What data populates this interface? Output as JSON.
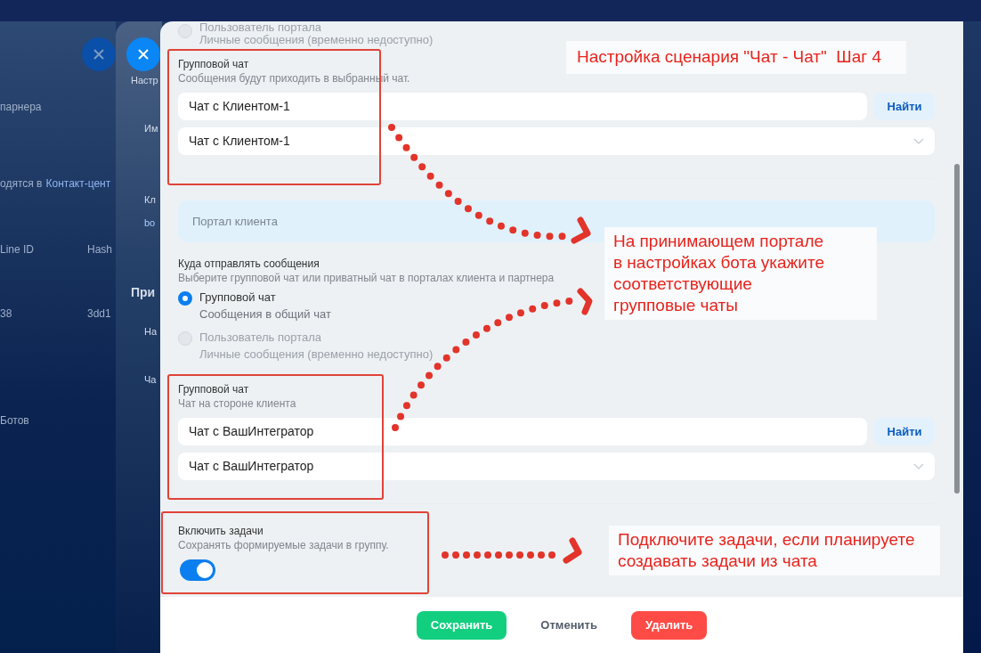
{
  "back_panel": {
    "texts": [
      {
        "kind": "text",
        "text": "парнера"
      },
      {
        "kind": "link-line",
        "text": "одятся в",
        "link": "Контакт-цент"
      },
      {
        "kind": "pair",
        "text": "Line ID",
        "second": "Hash"
      },
      {
        "kind": "pair",
        "text": "38",
        "second": "3dd1"
      },
      {
        "kind": "text",
        "text": "Ботов"
      }
    ]
  },
  "middle_panel": {
    "texts": [
      {
        "kind": "hint",
        "text": "Настр"
      },
      {
        "kind": "label",
        "text": "Им"
      },
      {
        "kind": "label",
        "text": "Кл"
      },
      {
        "kind": "link",
        "text": "bo"
      },
      {
        "kind": "heading",
        "text": "При"
      },
      {
        "kind": "label",
        "text": "На"
      },
      {
        "kind": "label",
        "text": "Ча"
      }
    ]
  },
  "form": {
    "top_option": {
      "label": "Пользователь портала",
      "hint": "Личные сообщения (временно недоступно)",
      "selected": false,
      "disabled": true
    },
    "partner_chat": {
      "label": "Групповой чат",
      "hint": "Сообщения будут приходить в выбранный чат.",
      "search_value": "Чат с Клиентом-1",
      "search_button": "Найти",
      "selected_chat": "Чат с Клиентом-1"
    },
    "client_portal": {
      "title": "Портал клиента"
    },
    "destination": {
      "label": "Куда отправлять сообщения",
      "hint": "Выберите групповой чат или приватный чат в порталах клиента и партнера",
      "options": [
        {
          "label": "Групповой чат",
          "hint": "Сообщения в общий чат",
          "selected": true,
          "disabled": false
        },
        {
          "label": "Пользователь портала",
          "hint": "Личные сообщения (временно недоступно)",
          "selected": false,
          "disabled": true
        }
      ]
    },
    "client_chat": {
      "label": "Групповой чат",
      "hint": "Чат на стороне клиента",
      "search_value": "Чат с ВашИнтегратор",
      "search_button": "Найти",
      "selected_chat": "Чат с ВашИнтегратор"
    },
    "tasks": {
      "label": "Включить задачи",
      "hint": "Сохранять формируемые задачи в группу.",
      "on": true
    }
  },
  "footer": {
    "buttons": [
      {
        "label": "Сохранить",
        "kind": "save"
      },
      {
        "label": "Отменить",
        "kind": "cancel"
      },
      {
        "label": "Удалить",
        "kind": "delete"
      }
    ]
  },
  "annotations": {
    "title": "Настройка сценария \"Чат - Чат\"  Шаг 4",
    "callouts": [
      {
        "text": "На принимающем портале\nв настройках бота укажите\nсоответствующие\nгрупповые чаты"
      },
      {
        "text": "Подключите задачи, если планируете\nсоздавать задачи из чата"
      }
    ]
  }
}
